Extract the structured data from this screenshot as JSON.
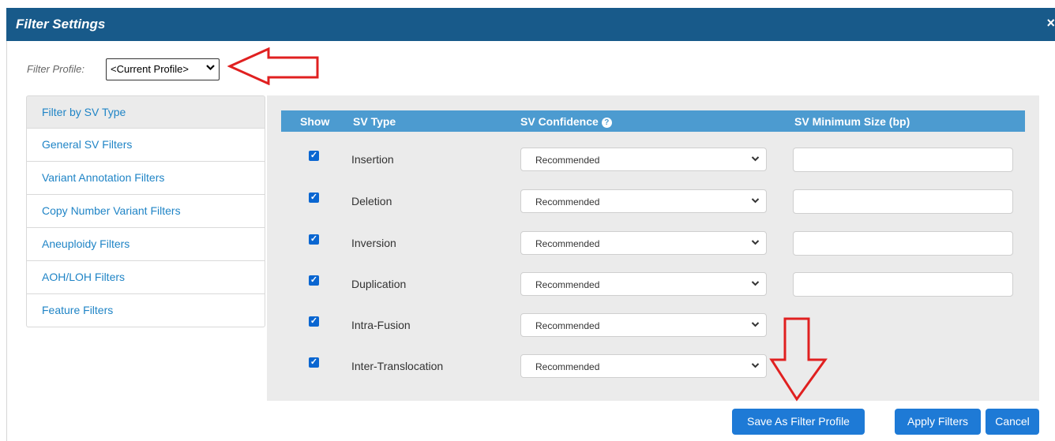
{
  "dialog": {
    "title": "Filter Settings",
    "close_glyph": "×"
  },
  "profile": {
    "label": "Filter Profile:",
    "selected": "<Current Profile>",
    "chevron": "❯"
  },
  "tabs": [
    {
      "label": "Filter by SV Type"
    },
    {
      "label": "General SV Filters"
    },
    {
      "label": "Variant Annotation Filters"
    },
    {
      "label": "Copy Number Variant Filters"
    },
    {
      "label": "Aneuploidy Filters"
    },
    {
      "label": "AOH/LOH Filters"
    },
    {
      "label": "Feature Filters"
    }
  ],
  "table": {
    "headers": {
      "show": "Show",
      "sv_type": "SV Type",
      "confidence": "SV Confidence",
      "min_size": "SV Minimum Size (bp)"
    },
    "help_icon": "?",
    "rows": [
      {
        "checked": true,
        "sv_type": "Insertion",
        "confidence": "Recommended",
        "min_size": ""
      },
      {
        "checked": true,
        "sv_type": "Deletion",
        "confidence": "Recommended",
        "min_size": ""
      },
      {
        "checked": true,
        "sv_type": "Inversion",
        "confidence": "Recommended",
        "min_size": ""
      },
      {
        "checked": true,
        "sv_type": "Duplication",
        "confidence": "Recommended",
        "min_size": ""
      },
      {
        "checked": true,
        "sv_type": "Intra-Fusion",
        "confidence": "Recommended"
      },
      {
        "checked": true,
        "sv_type": "Inter-Translocation",
        "confidence": "Recommended"
      }
    ]
  },
  "buttons": {
    "save_profile": "Save As Filter Profile",
    "apply": "Apply Filters",
    "cancel": "Cancel"
  },
  "colors": {
    "header_bar": "#185a8a",
    "table_header": "#4c9bd0",
    "button": "#1e7ad6",
    "annotation_arrow": "#e02020"
  }
}
